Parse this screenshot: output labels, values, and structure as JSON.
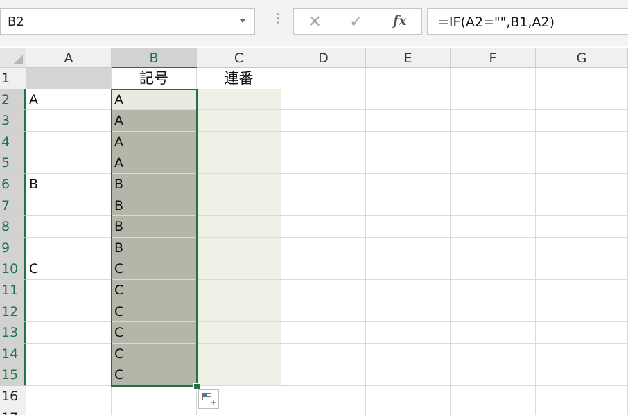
{
  "name_box": {
    "value": "B2"
  },
  "formula_bar": {
    "cancel_glyph": "✕",
    "enter_glyph": "✓",
    "fx_label": "fx",
    "formula": "=IF(A2=\"\",B1,A2)"
  },
  "columns": [
    "A",
    "B",
    "C",
    "D",
    "E",
    "F",
    "G"
  ],
  "selected_column": "B",
  "rows": [
    {
      "num": "1",
      "a": "",
      "b": "記号",
      "c": "連番"
    },
    {
      "num": "2",
      "a": "A",
      "b": "A",
      "c": ""
    },
    {
      "num": "3",
      "a": "",
      "b": "A",
      "c": ""
    },
    {
      "num": "4",
      "a": "",
      "b": "A",
      "c": ""
    },
    {
      "num": "5",
      "a": "",
      "b": "A",
      "c": ""
    },
    {
      "num": "6",
      "a": "B",
      "b": "B",
      "c": ""
    },
    {
      "num": "7",
      "a": "",
      "b": "B",
      "c": ""
    },
    {
      "num": "8",
      "a": "",
      "b": "B",
      "c": ""
    },
    {
      "num": "9",
      "a": "",
      "b": "B",
      "c": ""
    },
    {
      "num": "10",
      "a": "C",
      "b": "C",
      "c": ""
    },
    {
      "num": "11",
      "a": "",
      "b": "C",
      "c": ""
    },
    {
      "num": "12",
      "a": "",
      "b": "C",
      "c": ""
    },
    {
      "num": "13",
      "a": "",
      "b": "C",
      "c": ""
    },
    {
      "num": "14",
      "a": "",
      "b": "C",
      "c": ""
    },
    {
      "num": "15",
      "a": "",
      "b": "C",
      "c": ""
    },
    {
      "num": "16",
      "a": "",
      "b": "",
      "c": ""
    },
    {
      "num": "17",
      "a": "",
      "b": "",
      "c": ""
    }
  ],
  "colors": {
    "accent": "#217346",
    "selection_fill": "#b3b6a8",
    "fill_c": "#edf0e4"
  },
  "icons": {
    "autofill_options": "autofill-options-icon",
    "dropdown": "chevron-down-icon"
  }
}
